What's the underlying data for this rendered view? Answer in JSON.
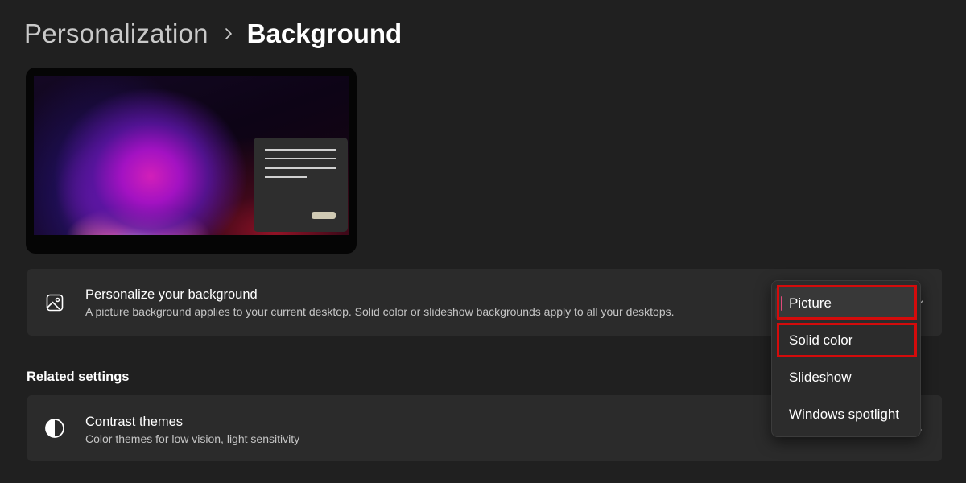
{
  "breadcrumb": {
    "parent": "Personalization",
    "current": "Background"
  },
  "background_card": {
    "title": "Personalize your background",
    "description": "A picture background applies to your current desktop. Solid color or slideshow backgrounds apply to all your desktops.",
    "icon": "picture-icon"
  },
  "dropdown": {
    "selected": "Picture",
    "options": [
      "Picture",
      "Solid color",
      "Slideshow",
      "Windows spotlight"
    ],
    "highlighted": [
      "Picture",
      "Solid color"
    ]
  },
  "related": {
    "heading": "Related settings",
    "contrast": {
      "title": "Contrast themes",
      "description": "Color themes for low vision, light sensitivity",
      "icon": "contrast-icon"
    }
  },
  "colors": {
    "window_bg": "#202020",
    "card_bg": "#2b2b2b",
    "highlight_box": "#d40b0b",
    "accent_indicator": "#e04a7a"
  }
}
